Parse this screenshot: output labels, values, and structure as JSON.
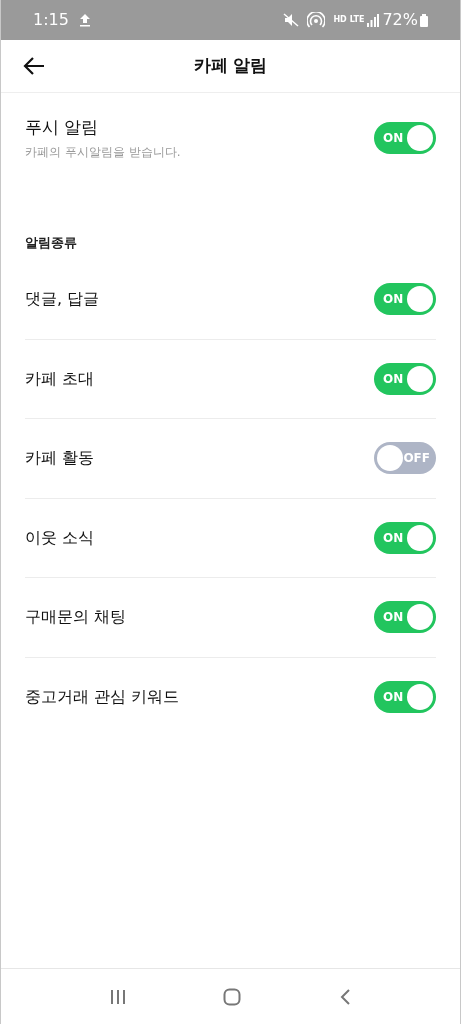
{
  "status_bar": {
    "time": "1:15",
    "network_labels": [
      "HD",
      "LTE"
    ],
    "battery": "72%"
  },
  "header": {
    "title": "카페 알림"
  },
  "push": {
    "title": "푸시 알림",
    "subtitle": "카페의 푸시알림을 받습니다.",
    "on": true,
    "toggle_label": "ON"
  },
  "section_title": "알림종류",
  "items": [
    {
      "label": "댓글, 답글",
      "on": true,
      "toggle_label": "ON"
    },
    {
      "label": "카페 초대",
      "on": true,
      "toggle_label": "ON"
    },
    {
      "label": "카페 활동",
      "on": false,
      "toggle_label": "OFF"
    },
    {
      "label": "이웃 소식",
      "on": true,
      "toggle_label": "ON"
    },
    {
      "label": "구매문의 채팅",
      "on": true,
      "toggle_label": "ON"
    },
    {
      "label": "중고거래 관심 키워드",
      "on": true,
      "toggle_label": "ON"
    }
  ]
}
